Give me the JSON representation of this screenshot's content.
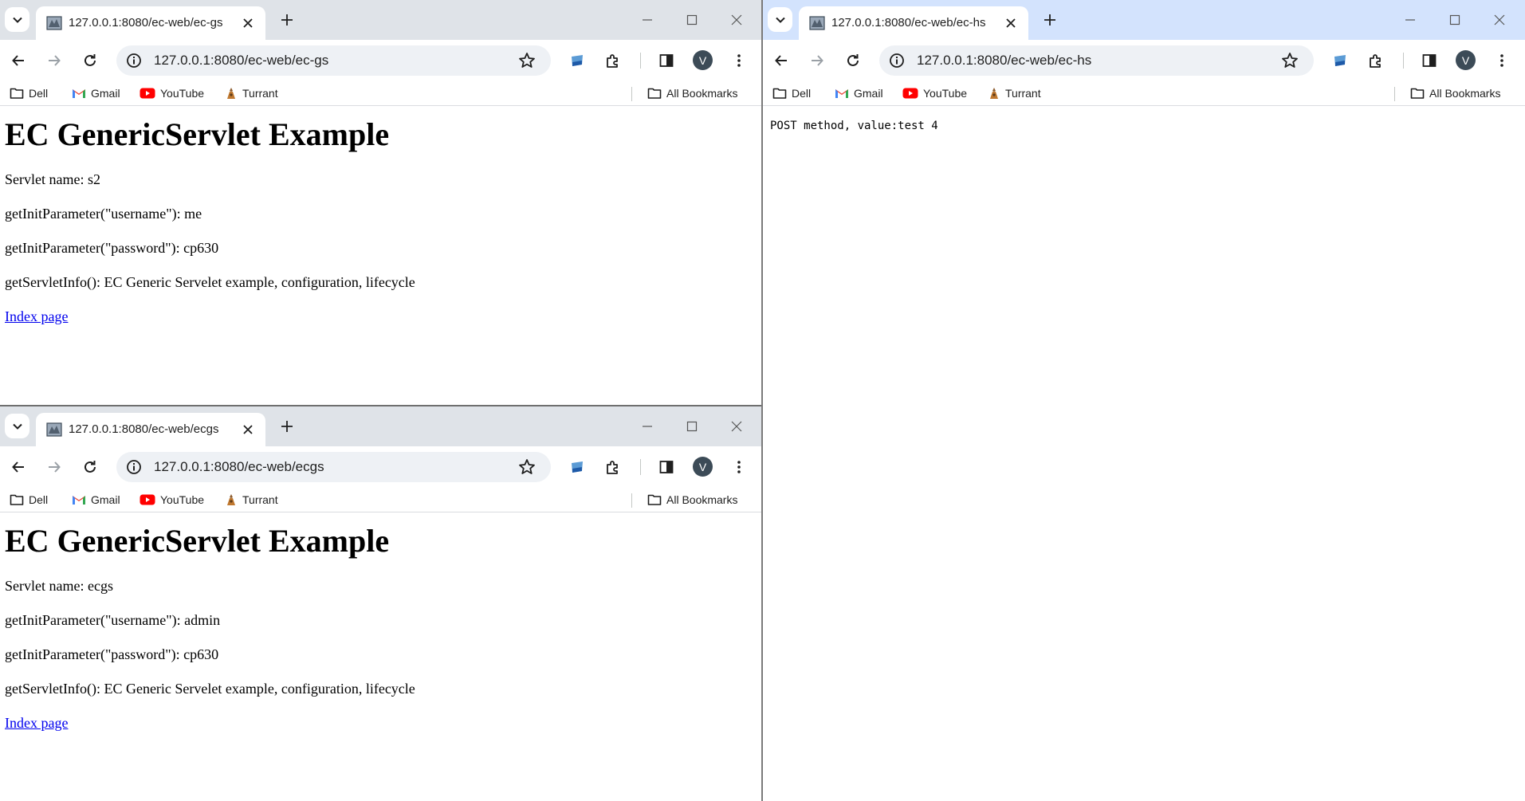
{
  "bookmarks": [
    "Dell",
    "Gmail",
    "YouTube",
    "Turrant"
  ],
  "all_bookmarks": "All Bookmarks",
  "avatar_letter": "V",
  "window_a": {
    "tab_title": "127.0.0.1:8080/ec-web/ec-gs",
    "url": "127.0.0.1:8080/ec-web/ec-gs",
    "heading": "EC GenericServlet Example",
    "lines": [
      "Servlet name: s2",
      "getInitParameter(\"username\"): me",
      "getInitParameter(\"password\"): cp630",
      "getServletInfo(): EC Generic Servelet example, configuration, lifecycle"
    ],
    "link": "Index page"
  },
  "window_b": {
    "tab_title": "127.0.0.1:8080/ec-web/ecgs",
    "url": "127.0.0.1:8080/ec-web/ecgs",
    "heading": "EC GenericServlet Example",
    "lines": [
      "Servlet name: ecgs",
      "getInitParameter(\"username\"): admin",
      "getInitParameter(\"password\"): cp630",
      "getServletInfo(): EC Generic Servelet example, configuration, lifecycle"
    ],
    "link": "Index page"
  },
  "window_c": {
    "tab_title": "127.0.0.1:8080/ec-web/ec-hs",
    "url": "127.0.0.1:8080/ec-web/ec-hs",
    "body_text": "POST method, value:test 4"
  },
  "colors": {
    "active_tabbar": "#d3e3fd",
    "inactive_tabbar": "#dfe3e8",
    "link": "#0000ee",
    "avatar_bg": "#3c4b57",
    "youtube_red": "#ff0000"
  }
}
